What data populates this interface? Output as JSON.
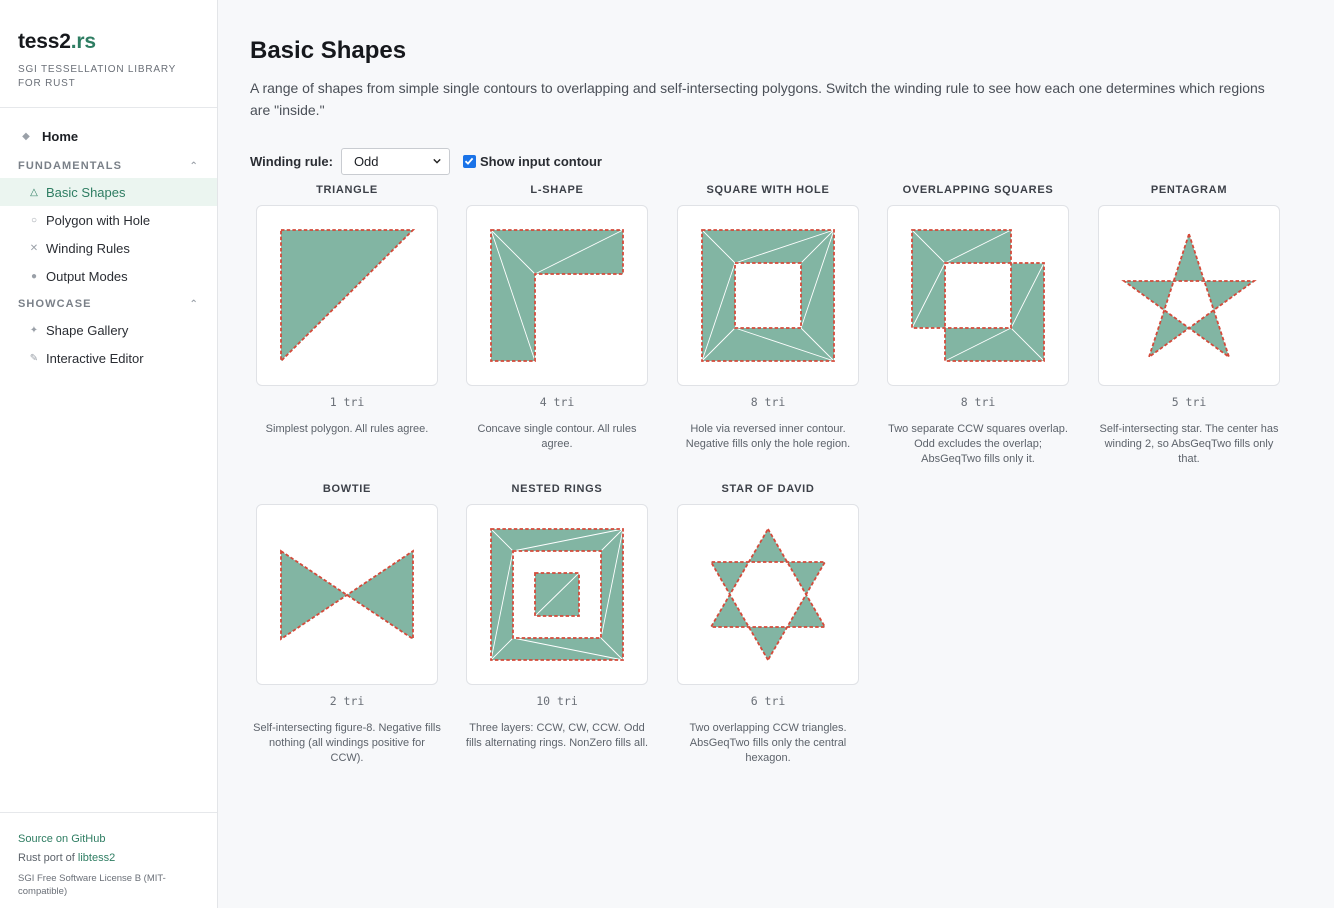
{
  "sidebar": {
    "brand_main": "tess2",
    "brand_ext": ".rs",
    "subtitle": "SGI TESSELLATION LIBRARY FOR RUST",
    "home_label": "Home",
    "sections": [
      {
        "title": "FUNDAMENTALS",
        "items": [
          {
            "label": "Basic Shapes",
            "icon": "triangle-icon",
            "glyph": "△"
          },
          {
            "label": "Polygon with Hole",
            "icon": "circle-outline-icon",
            "glyph": "○"
          },
          {
            "label": "Winding Rules",
            "icon": "cross-icon",
            "glyph": "✕"
          },
          {
            "label": "Output Modes",
            "icon": "dot-icon",
            "glyph": "●"
          }
        ]
      },
      {
        "title": "SHOWCASE",
        "items": [
          {
            "label": "Shape Gallery",
            "icon": "sparkle-icon",
            "glyph": "✦"
          },
          {
            "label": "Interactive Editor",
            "icon": "pen-icon",
            "glyph": "✎"
          }
        ]
      }
    ],
    "footer": {
      "source_link": "Source on GitHub",
      "port_prefix": "Rust port of ",
      "port_link": "libtess2",
      "license": "SGI Free Software License B (MIT-compatible)"
    }
  },
  "main": {
    "title": "Basic Shapes",
    "description": "A range of shapes from simple single contours to overlapping and self-intersecting polygons. Switch the winding rule to see how each one determines which regions are \"inside.\"",
    "controls": {
      "winding_label": "Winding rule:",
      "winding_value": "Odd",
      "contour_label": "Show input contour",
      "contour_checked": true
    },
    "shapes": [
      {
        "title": "TRIANGLE",
        "count": "1 tri",
        "desc": "Simplest polygon. All rules agree."
      },
      {
        "title": "L-SHAPE",
        "count": "4 tri",
        "desc": "Concave single contour. All rules agree."
      },
      {
        "title": "SQUARE WITH HOLE",
        "count": "8 tri",
        "desc": "Hole via reversed inner contour. Negative fills only the hole region."
      },
      {
        "title": "OVERLAPPING SQUARES",
        "count": "8 tri",
        "desc": "Two separate CCW squares overlap. Odd excludes the overlap; AbsGeqTwo fills only it."
      },
      {
        "title": "PENTAGRAM",
        "count": "5 tri",
        "desc": "Self-intersecting star. The center has winding 2, so AbsGeqTwo fills only that."
      },
      {
        "title": "BOWTIE",
        "count": "2 tri",
        "desc": "Self-intersecting figure-8. Negative fills nothing (all windings positive for CCW)."
      },
      {
        "title": "NESTED RINGS",
        "count": "10 tri",
        "desc": "Three layers: CCW, CW, CCW. Odd fills alternating rings. NonZero fills all."
      },
      {
        "title": "STAR OF DAVID",
        "count": "6 tri",
        "desc": "Two overlapping CCW triangles. AbsGeqTwo fills only the central hexagon."
      }
    ]
  },
  "colors": {
    "accent": "#2e7d62",
    "fill": "#82b5a3",
    "outline": "#d44a3a",
    "checkbox": "#1a73e8"
  }
}
